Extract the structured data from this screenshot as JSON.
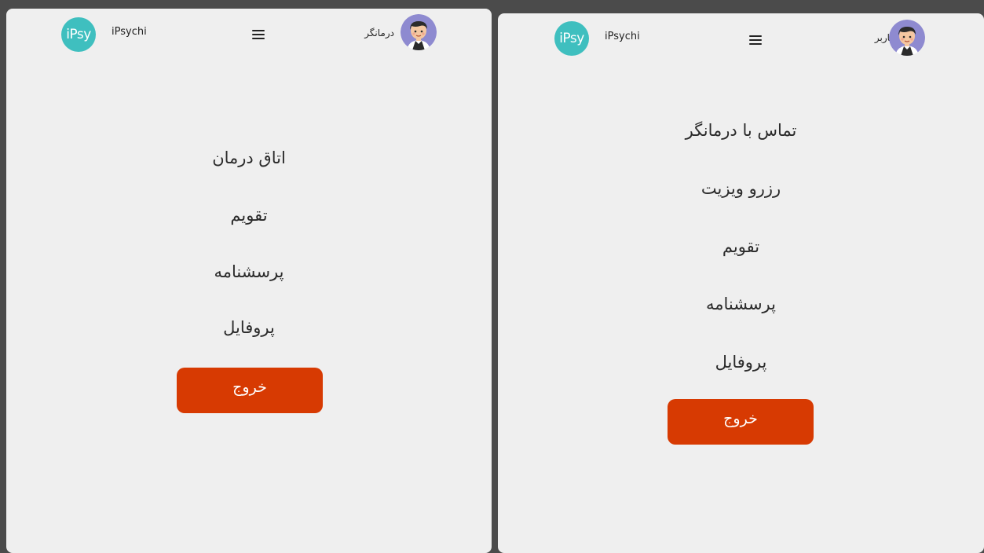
{
  "left_screen": {
    "header": {
      "logo_text": "iPsy",
      "app_name": "iPsychi",
      "menu_icon": "hamburger-icon",
      "user_role": "درمانگر",
      "avatar_icon": "avatar-icon"
    },
    "menu": {
      "items": [
        {
          "label": "اتاق درمان"
        },
        {
          "label": "تقویم"
        },
        {
          "label": "پرسشنامه"
        },
        {
          "label": "پروفایل"
        }
      ],
      "logout_label": "خروج"
    }
  },
  "right_screen": {
    "header": {
      "logo_text": "iPsy",
      "app_name": "iPsychi",
      "menu_icon": "hamburger-icon",
      "user_role": "کاربر",
      "avatar_icon": "avatar-icon"
    },
    "menu": {
      "items": [
        {
          "label": "تماس با درمانگر"
        },
        {
          "label": "رزرو ویزیت"
        },
        {
          "label": "تقویم"
        },
        {
          "label": "پرسشنامه"
        },
        {
          "label": "پروفایل"
        }
      ],
      "logout_label": "خروج"
    }
  },
  "colors": {
    "background": "#4b4b4b",
    "panel": "#efefef",
    "logo_teal": "#3fbfbf",
    "logout_red": "#d73a02",
    "avatar_bg": "#8e8ad0"
  }
}
